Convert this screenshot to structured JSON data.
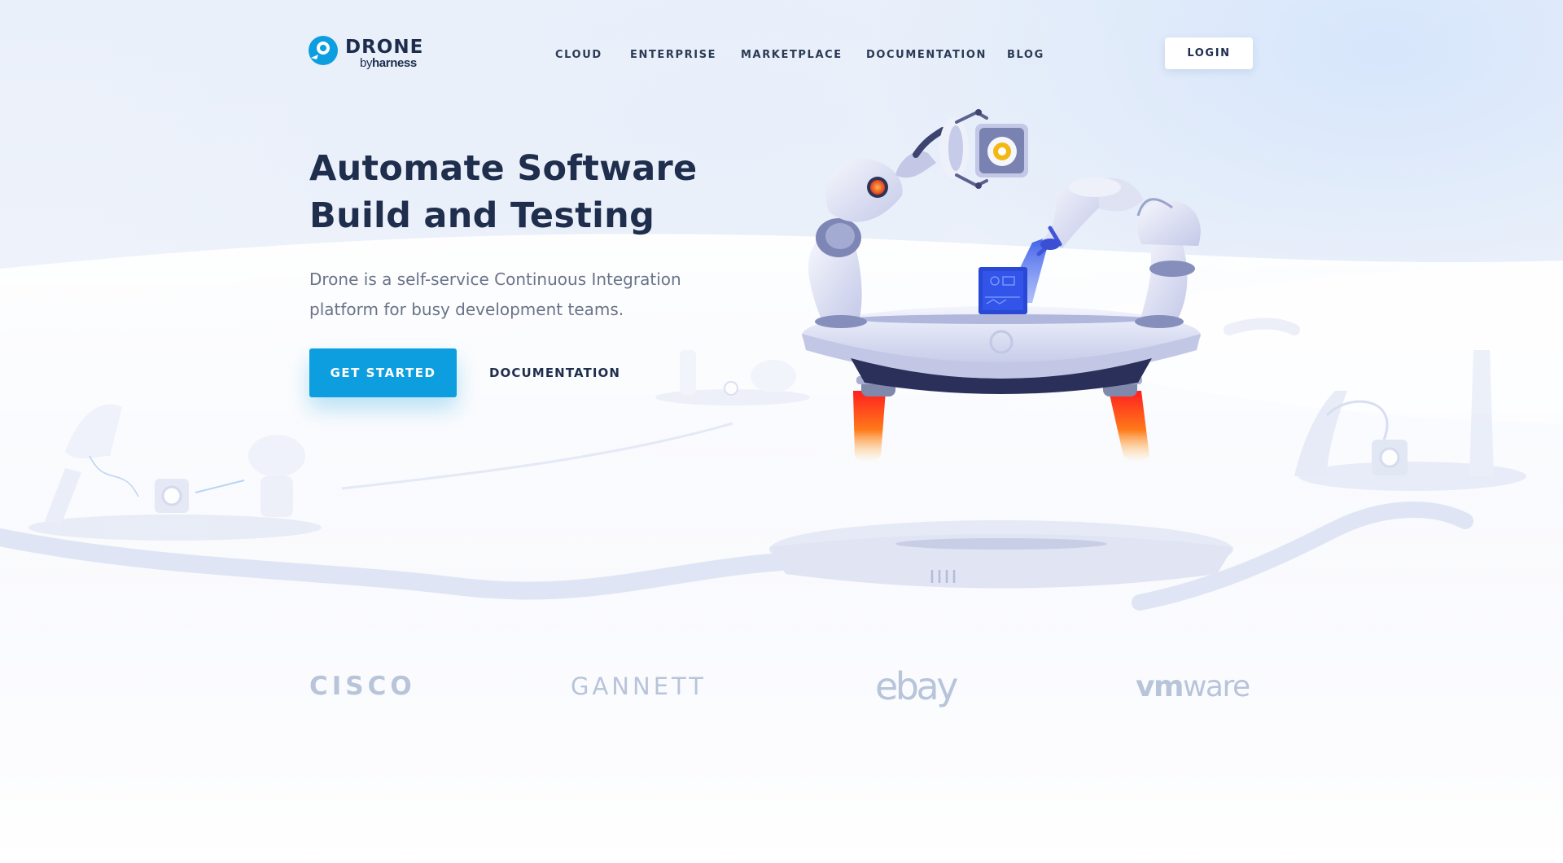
{
  "header": {
    "logo": {
      "name": "DRONE",
      "by": "by",
      "company": "harness"
    },
    "nav": [
      "CLOUD",
      "ENTERPRISE",
      "MARKETPLACE",
      "DOCUMENTATION",
      "BLOG"
    ],
    "login_label": "LOGIN"
  },
  "hero": {
    "title_lines": [
      "Automate Software",
      "Build and Testing"
    ],
    "subtitle_lines": [
      "Drone is a self-service Continuous Integration",
      "platform for busy development teams."
    ],
    "cta_primary": "GET STARTED",
    "cta_secondary": "DOCUMENTATION"
  },
  "customers": {
    "cisco": "CISCO",
    "gannett": "GANNETT",
    "ebay": "ebay",
    "vmware_bold": "vm",
    "vmware_rest": "ware"
  },
  "colors": {
    "brand": "#0d9edf",
    "heading": "#1f2e4d",
    "body_text": "#6a7388",
    "customer_logo": "#b7c4d9",
    "background": "#eaf0fa"
  },
  "icons": {
    "logo_mark": "drone-logo-icon",
    "hero_art": "robot-arms-illustration"
  }
}
